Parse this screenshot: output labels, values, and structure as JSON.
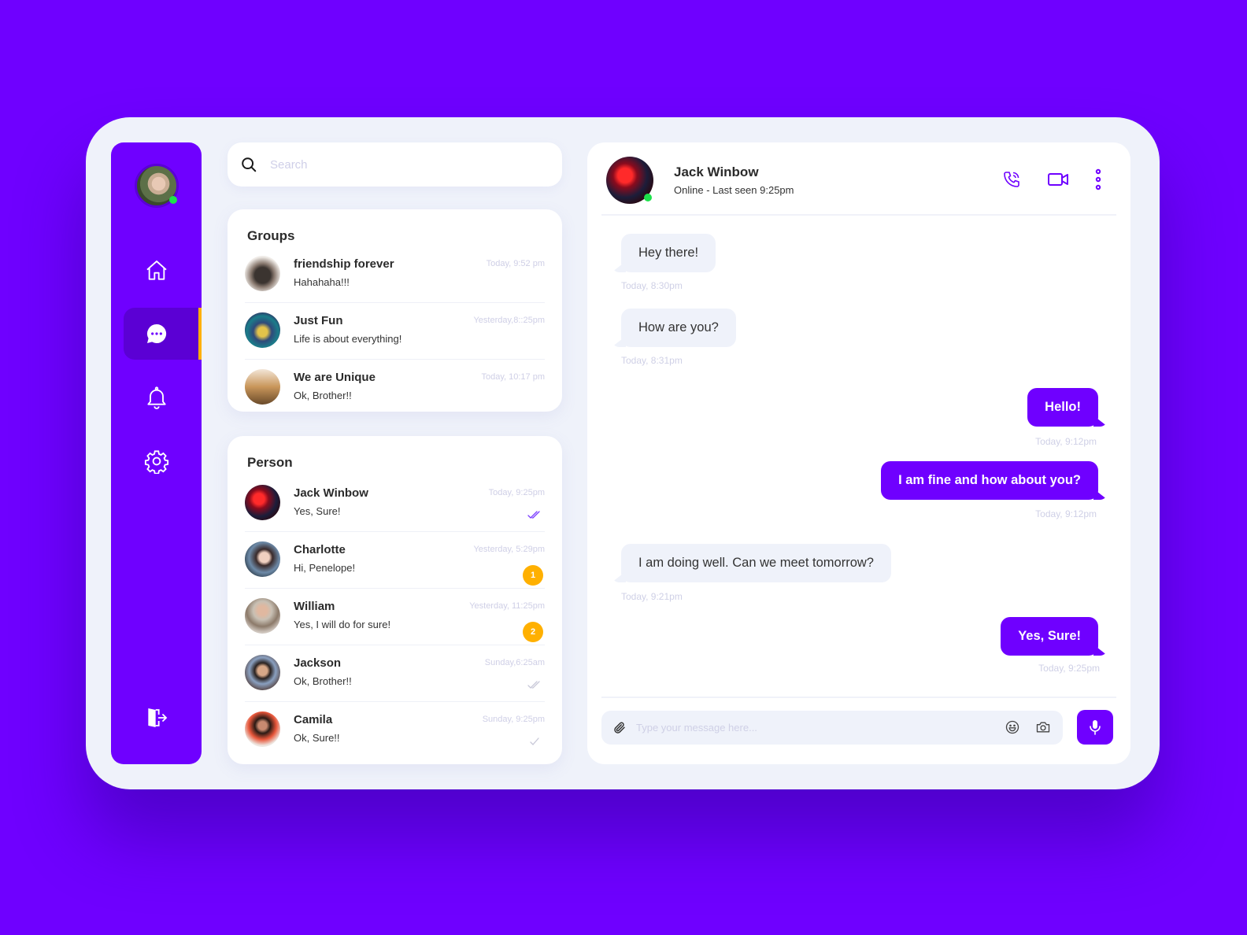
{
  "colors": {
    "accent": "#6f00ff",
    "badge": "#ffb000",
    "online": "#1ee24c",
    "surface": "#eff2fa"
  },
  "sidebar": {
    "items": [
      {
        "icon": "home-icon",
        "active": false
      },
      {
        "icon": "chat-icon",
        "active": true
      },
      {
        "icon": "bell-icon",
        "active": false
      },
      {
        "icon": "gear-icon",
        "active": false
      }
    ],
    "logout_icon": "logout-icon"
  },
  "search": {
    "placeholder": "Search",
    "value": ""
  },
  "groups": {
    "title": "Groups",
    "items": [
      {
        "name": "friendship forever",
        "preview": "Hahahaha!!!",
        "time": "Today, 9:52 pm"
      },
      {
        "name": "Just Fun",
        "preview": "Life is about everything!",
        "time": "Yesterday,8::25pm"
      },
      {
        "name": "We are Unique",
        "preview": "Ok, Brother!!",
        "time": "Today, 10:17 pm"
      }
    ]
  },
  "persons": {
    "title": "Person",
    "items": [
      {
        "name": "Jack Winbow",
        "preview": "Yes, Sure!",
        "time": "Today, 9:25pm",
        "status": "read"
      },
      {
        "name": "Charlotte",
        "preview": "Hi, Penelope!",
        "time": "Yesterday, 5:29pm",
        "unread": "1"
      },
      {
        "name": "William",
        "preview": "Yes, I will do for sure!",
        "time": "Yesterday, 11:25pm",
        "unread": "2"
      },
      {
        "name": "Jackson",
        "preview": "Ok, Brother!!",
        "time": "Sunday,6:25am",
        "status": "delivered"
      },
      {
        "name": "Camila",
        "preview": "Ok, Sure!!",
        "time": "Sunday, 9:25pm",
        "status": "sent"
      }
    ]
  },
  "chat": {
    "contact_name": "Jack Winbow",
    "contact_status": "Online - Last seen 9:25pm",
    "messages": [
      {
        "direction": "in",
        "text": "Hey there!",
        "time": "Today, 8:30pm"
      },
      {
        "direction": "in",
        "text": "How are you?",
        "time": "Today, 8:31pm"
      },
      {
        "direction": "out",
        "text": "Hello!",
        "time": "Today, 9:12pm"
      },
      {
        "direction": "out",
        "text": "I am fine and how about you?",
        "time": "Today, 9:12pm"
      },
      {
        "direction": "in",
        "text": "I am doing well. Can we meet tomorrow?",
        "time": "Today, 9:21pm"
      },
      {
        "direction": "out",
        "text": "Yes, Sure!",
        "time": "Today, 9:25pm"
      }
    ],
    "composer_placeholder": "Type your message here..."
  }
}
